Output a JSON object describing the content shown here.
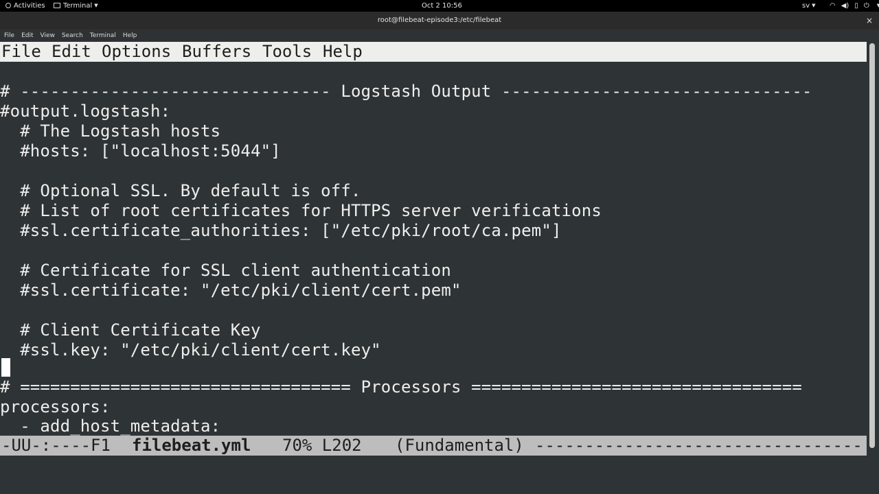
{
  "topbar": {
    "activities": "Activities",
    "app_name": "Terminal",
    "clock": "Oct 2  10:56",
    "language": "sv"
  },
  "window": {
    "title": "root@filebeat-episode3:/etc/filebeat",
    "close_glyph": "×"
  },
  "terminal_menu": [
    "File",
    "Edit",
    "View",
    "Search",
    "Terminal",
    "Help"
  ],
  "emacs_menu": [
    "File",
    "Edit",
    "Options",
    "Buffers",
    "Tools",
    "Help"
  ],
  "editor_lines": [
    "",
    "# ------------------------------- Logstash Output -------------------------------",
    "#output.logstash:",
    "  # The Logstash hosts",
    "  #hosts: [\"localhost:5044\"]",
    "",
    "  # Optional SSL. By default is off.",
    "  # List of root certificates for HTTPS server verifications",
    "  #ssl.certificate_authorities: [\"/etc/pki/root/ca.pem\"]",
    "",
    "  # Certificate for SSL client authentication",
    "  #ssl.certificate: \"/etc/pki/client/cert.pem\"",
    "",
    "  # Client Certificate Key",
    "  #ssl.key: \"/etc/pki/client/cert.key\"",
    "",
    "# ================================= Processors =================================",
    "processors:",
    "  - add_host_metadata:"
  ],
  "modeline": {
    "status": "-UU-:----F1",
    "buffer": "filebeat.yml",
    "position": "70% L202",
    "mode": "(Fundamental)",
    "dashes": "------------------------------------------------------------"
  },
  "colors": {
    "terminal_bg": "#2e3436",
    "terminal_fg": "#eeeeec",
    "menubar_bg": "#eeeeec",
    "modeline_bg": "#bdbdbd"
  }
}
